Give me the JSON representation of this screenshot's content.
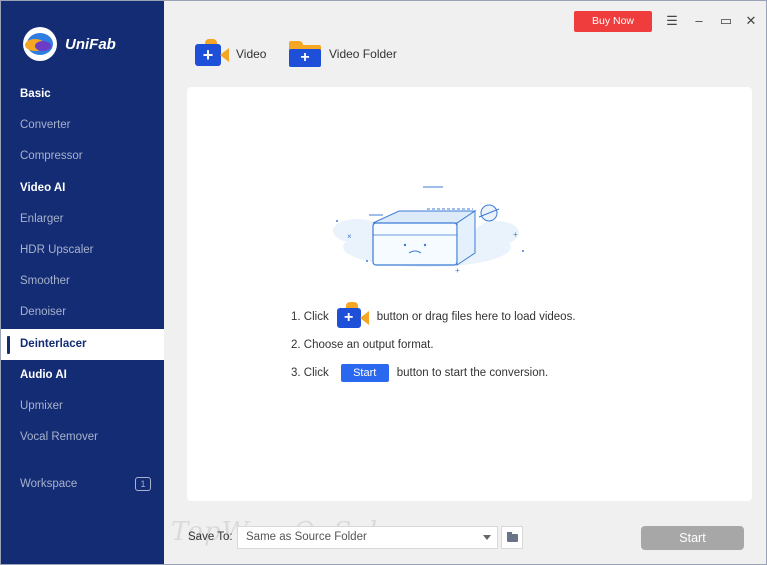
{
  "app": {
    "name": "UniFab"
  },
  "sidebar": {
    "items": [
      {
        "label": "Basic",
        "kind": "section"
      },
      {
        "label": "Converter",
        "kind": "item"
      },
      {
        "label": "Compressor",
        "kind": "item"
      },
      {
        "label": "Video AI",
        "kind": "section"
      },
      {
        "label": "Enlarger",
        "kind": "item"
      },
      {
        "label": "HDR Upscaler",
        "kind": "item"
      },
      {
        "label": "Smoother",
        "kind": "item"
      },
      {
        "label": "Denoiser",
        "kind": "item"
      },
      {
        "label": "Deinterlacer",
        "kind": "active"
      },
      {
        "label": "Audio AI",
        "kind": "section"
      },
      {
        "label": "Upmixer",
        "kind": "item"
      },
      {
        "label": "Vocal Remover",
        "kind": "item"
      }
    ],
    "workspace": {
      "label": "Workspace",
      "count": "1"
    }
  },
  "titlebar": {
    "buy_now": "Buy Now",
    "menu_icon": "menu-icon",
    "minimize_icon": "minimize-icon",
    "maximize_icon": "maximize-icon",
    "close_icon": "close-icon"
  },
  "toolbar": {
    "video_label": "Video",
    "video_folder_label": "Video Folder"
  },
  "instructions": {
    "step1_prefix": "1. Click",
    "step1_suffix": "button or drag files here to load videos.",
    "step2": "2. Choose an output format.",
    "step3_prefix": "3. Click",
    "step3_button": "Start",
    "step3_suffix": "button to start the conversion."
  },
  "bottom": {
    "save_to_label": "Save To:",
    "save_to_value": "Same as Source Folder",
    "start_label": "Start",
    "watermark": "TopWareOnSale"
  },
  "colors": {
    "sidebar": "#142c74",
    "buy_now": "#ef3c3c",
    "accent": "#2b68f0",
    "icon_orange": "#f5a623"
  }
}
